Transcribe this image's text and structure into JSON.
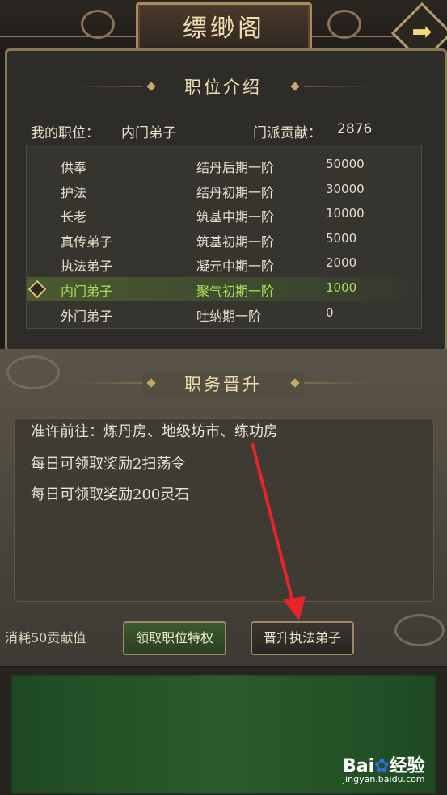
{
  "header": {
    "title": "缥缈阁",
    "arrow_icon": "right-arrow-icon"
  },
  "position_intro": {
    "section_title": "职位介绍",
    "my_position_label": "我的职位：",
    "my_position_value": "内门弟子",
    "contribution_label": "门派贡献：",
    "contribution_value": "2876",
    "ranks": [
      {
        "name": "供奉",
        "realm": "结丹后期一阶",
        "contribution": "50000"
      },
      {
        "name": "护法",
        "realm": "结丹初期一阶",
        "contribution": "30000"
      },
      {
        "name": "长老",
        "realm": "筑基中期一阶",
        "contribution": "10000"
      },
      {
        "name": "真传弟子",
        "realm": "筑基初期一阶",
        "contribution": "5000"
      },
      {
        "name": "执法弟子",
        "realm": "凝元中期一阶",
        "contribution": "2000"
      },
      {
        "name": "内门弟子",
        "realm": "聚气初期一阶",
        "contribution": "1000"
      },
      {
        "name": "外门弟子",
        "realm": "吐纳期一阶",
        "contribution": "0"
      }
    ],
    "selected_index": 5,
    "highlight_color": "#a8e05a"
  },
  "promotion": {
    "section_title": "职务晋升",
    "lines": [
      "准许前往：炼丹房、地级坊市、练功房",
      "每日可领取奖励2扫荡令",
      "每日可领取奖励200灵石"
    ],
    "cost_text": "消耗50贡献值",
    "claim_button": "领取职位特权",
    "promote_button": "晋升执法弟子"
  },
  "watermark": {
    "brand": "Bai",
    "brand2": "经验",
    "url": "jingyan.baidu.com"
  }
}
